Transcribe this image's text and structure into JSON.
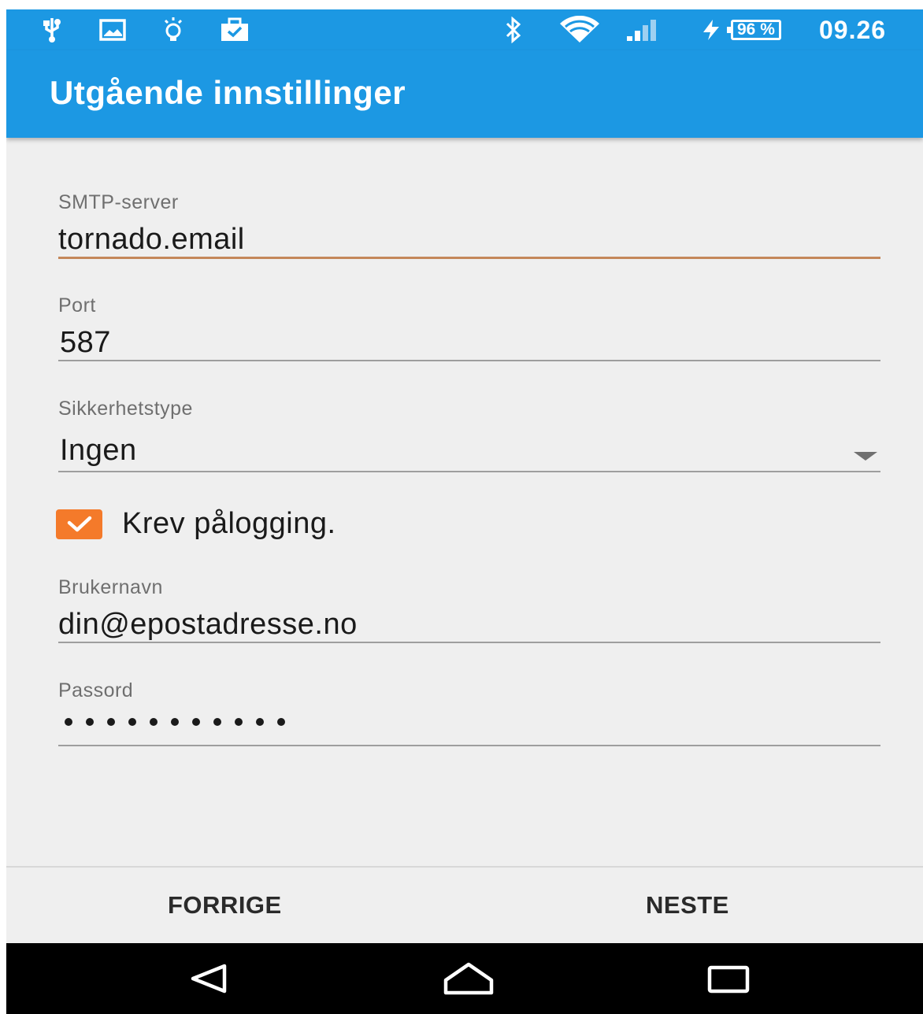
{
  "status_bar": {
    "icons_left": [
      "usb-icon",
      "image-icon",
      "lightbulb-icon",
      "briefcase-icon"
    ],
    "icons_right": [
      "bluetooth-icon",
      "wifi-icon",
      "signal-icon",
      "charging-icon"
    ],
    "battery": "96 %",
    "time": "09.26"
  },
  "app_bar": {
    "title": "Utgående innstillinger"
  },
  "form": {
    "smtp_server": {
      "label": "SMTP-server",
      "value": "tornado.email"
    },
    "port": {
      "label": "Port",
      "value": "587"
    },
    "security_type": {
      "label": "Sikkerhetstype",
      "value": "Ingen"
    },
    "require_login": {
      "label": "Krev pålogging.",
      "checked": true
    },
    "username": {
      "label": "Brukernavn",
      "value": "din@epostadresse.no"
    },
    "password": {
      "label": "Passord",
      "masked_length": 11
    }
  },
  "buttons": {
    "previous": "FORRIGE",
    "next": "NESTE"
  },
  "nav_bar": [
    "back-icon",
    "home-icon",
    "recents-icon"
  ],
  "colors": {
    "accent": "#1c98e3",
    "checkbox": "#f47a2a",
    "active_underline": "#c4875a"
  }
}
